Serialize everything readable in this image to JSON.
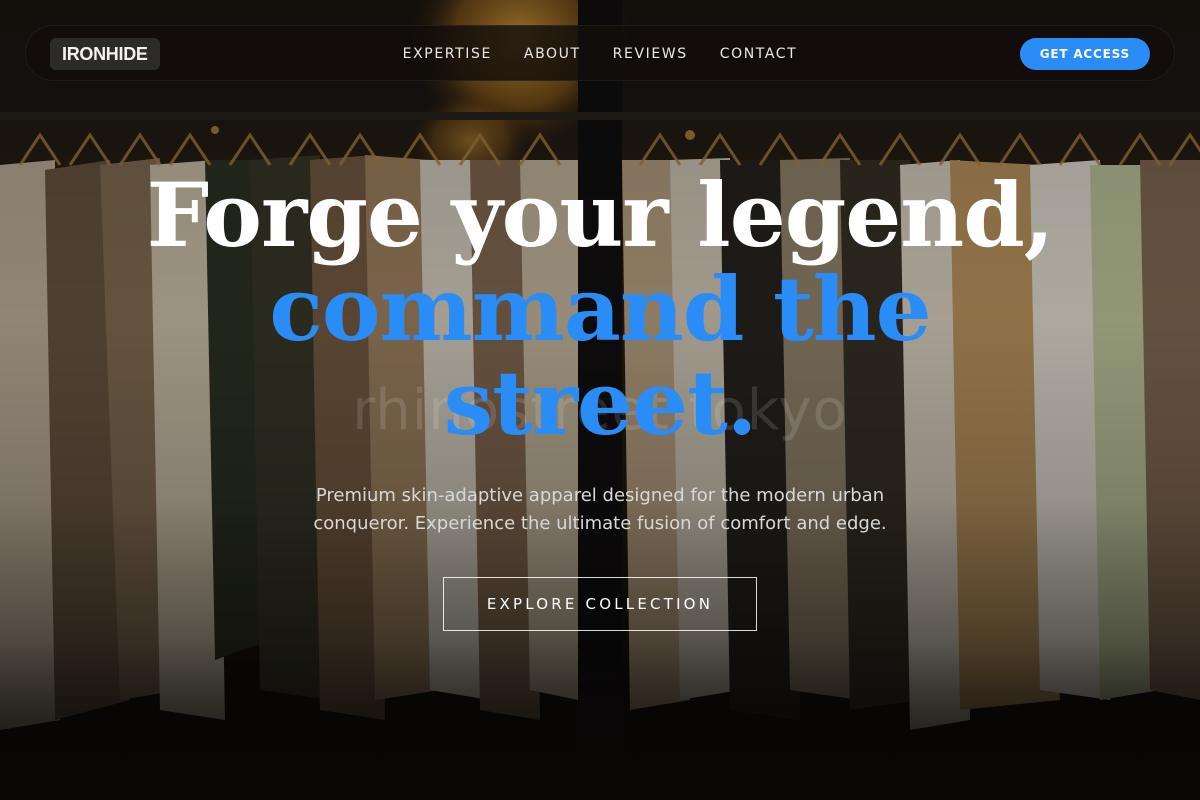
{
  "brand": {
    "logo_text": "IRONHIDE"
  },
  "nav": {
    "links": [
      {
        "label": "EXPERTISE"
      },
      {
        "label": "ABOUT"
      },
      {
        "label": "REVIEWS"
      },
      {
        "label": "CONTACT"
      }
    ],
    "cta_label": "GET ACCESS"
  },
  "hero": {
    "headline_line1": "Forge your legend,",
    "headline_line2": "command the",
    "headline_line3": "street.",
    "watermark_text": "rhinostreet tokyo",
    "subtext": "Premium skin-adaptive apparel designed for the modern urban conqueror. Experience the ultimate fusion of comfort and edge.",
    "button_label": "EXPLORE COLLECTION"
  },
  "colors": {
    "accent": "#2a8cf7",
    "nav_background": "#120e0a",
    "text_primary": "#ffffff",
    "text_secondary": "#d8d8d8"
  }
}
